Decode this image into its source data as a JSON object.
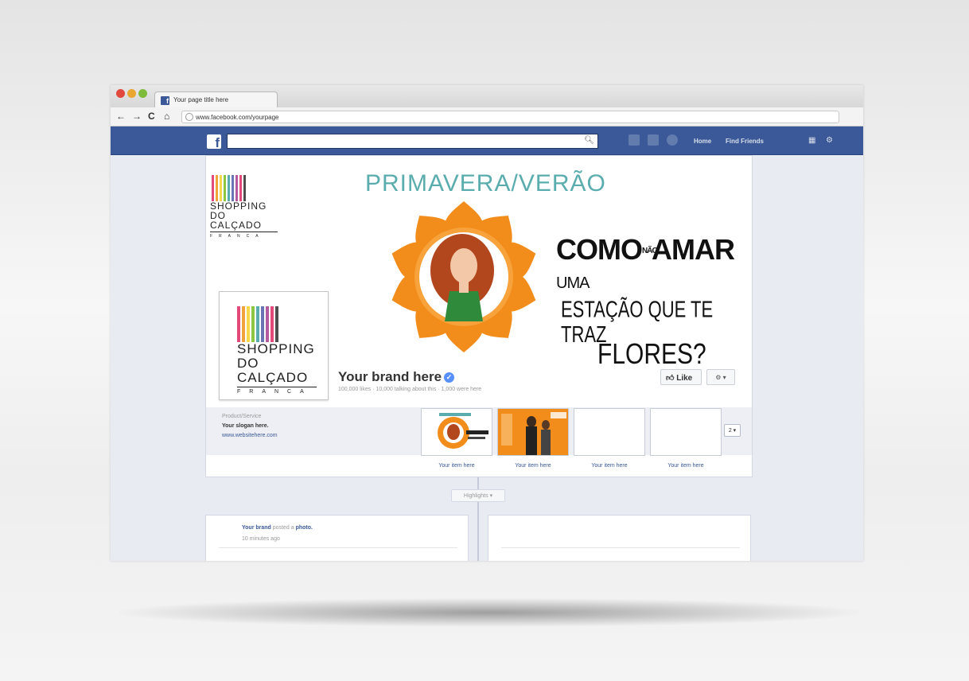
{
  "browser": {
    "tab_title": "Your page title here",
    "url": "www.facebook.com/yourpage",
    "nav": {
      "back": "←",
      "forward": "→",
      "reload": "C",
      "home": "⌂"
    }
  },
  "facebook": {
    "logo": "f",
    "nav_links": [
      "Home",
      "Find Friends"
    ]
  },
  "cover": {
    "headline": "PRIMAVERA/VERÃO",
    "tagline": {
      "como": "COMO",
      "nao": "NÃO",
      "amar": "AMAR",
      "uma": "UMA",
      "line2": "ESTAÇÃO QUE TE TRAZ",
      "line3": "FLORES?"
    },
    "logo": {
      "line1": "SHOPPING",
      "line2": "DO CALÇADO",
      "line3": "FRANCA"
    },
    "barcode_colors": [
      "#e34a7a",
      "#f0a23b",
      "#f6d84a",
      "#8dc63f",
      "#5aacae",
      "#6b73b5",
      "#b35aa0",
      "#e34a7a",
      "#4d4d4d"
    ]
  },
  "page": {
    "name": "Your brand here",
    "stats": "100,000 likes · 10,000 talking about this · 1,000 were here",
    "like_label": "Like",
    "gear_label": "⚙ ▾",
    "category": "Product/Service",
    "slogan": "Your slogan here.",
    "website": "www.websitehere.com",
    "apps": [
      {
        "label": "Your item here"
      },
      {
        "label": "Your item here"
      },
      {
        "label": "Your item here"
      },
      {
        "label": "Your item here"
      }
    ],
    "more_label": "2 ▾"
  },
  "timeline": {
    "highlights": "Highlights ▾",
    "post": {
      "author": "Your brand",
      "action": "posted a",
      "object": "photo.",
      "time": "10 minutes ago"
    }
  },
  "colors": {
    "fb_blue": "#3b5998",
    "headline_teal": "#5aacae",
    "flower_orange": "#f28c1b"
  }
}
